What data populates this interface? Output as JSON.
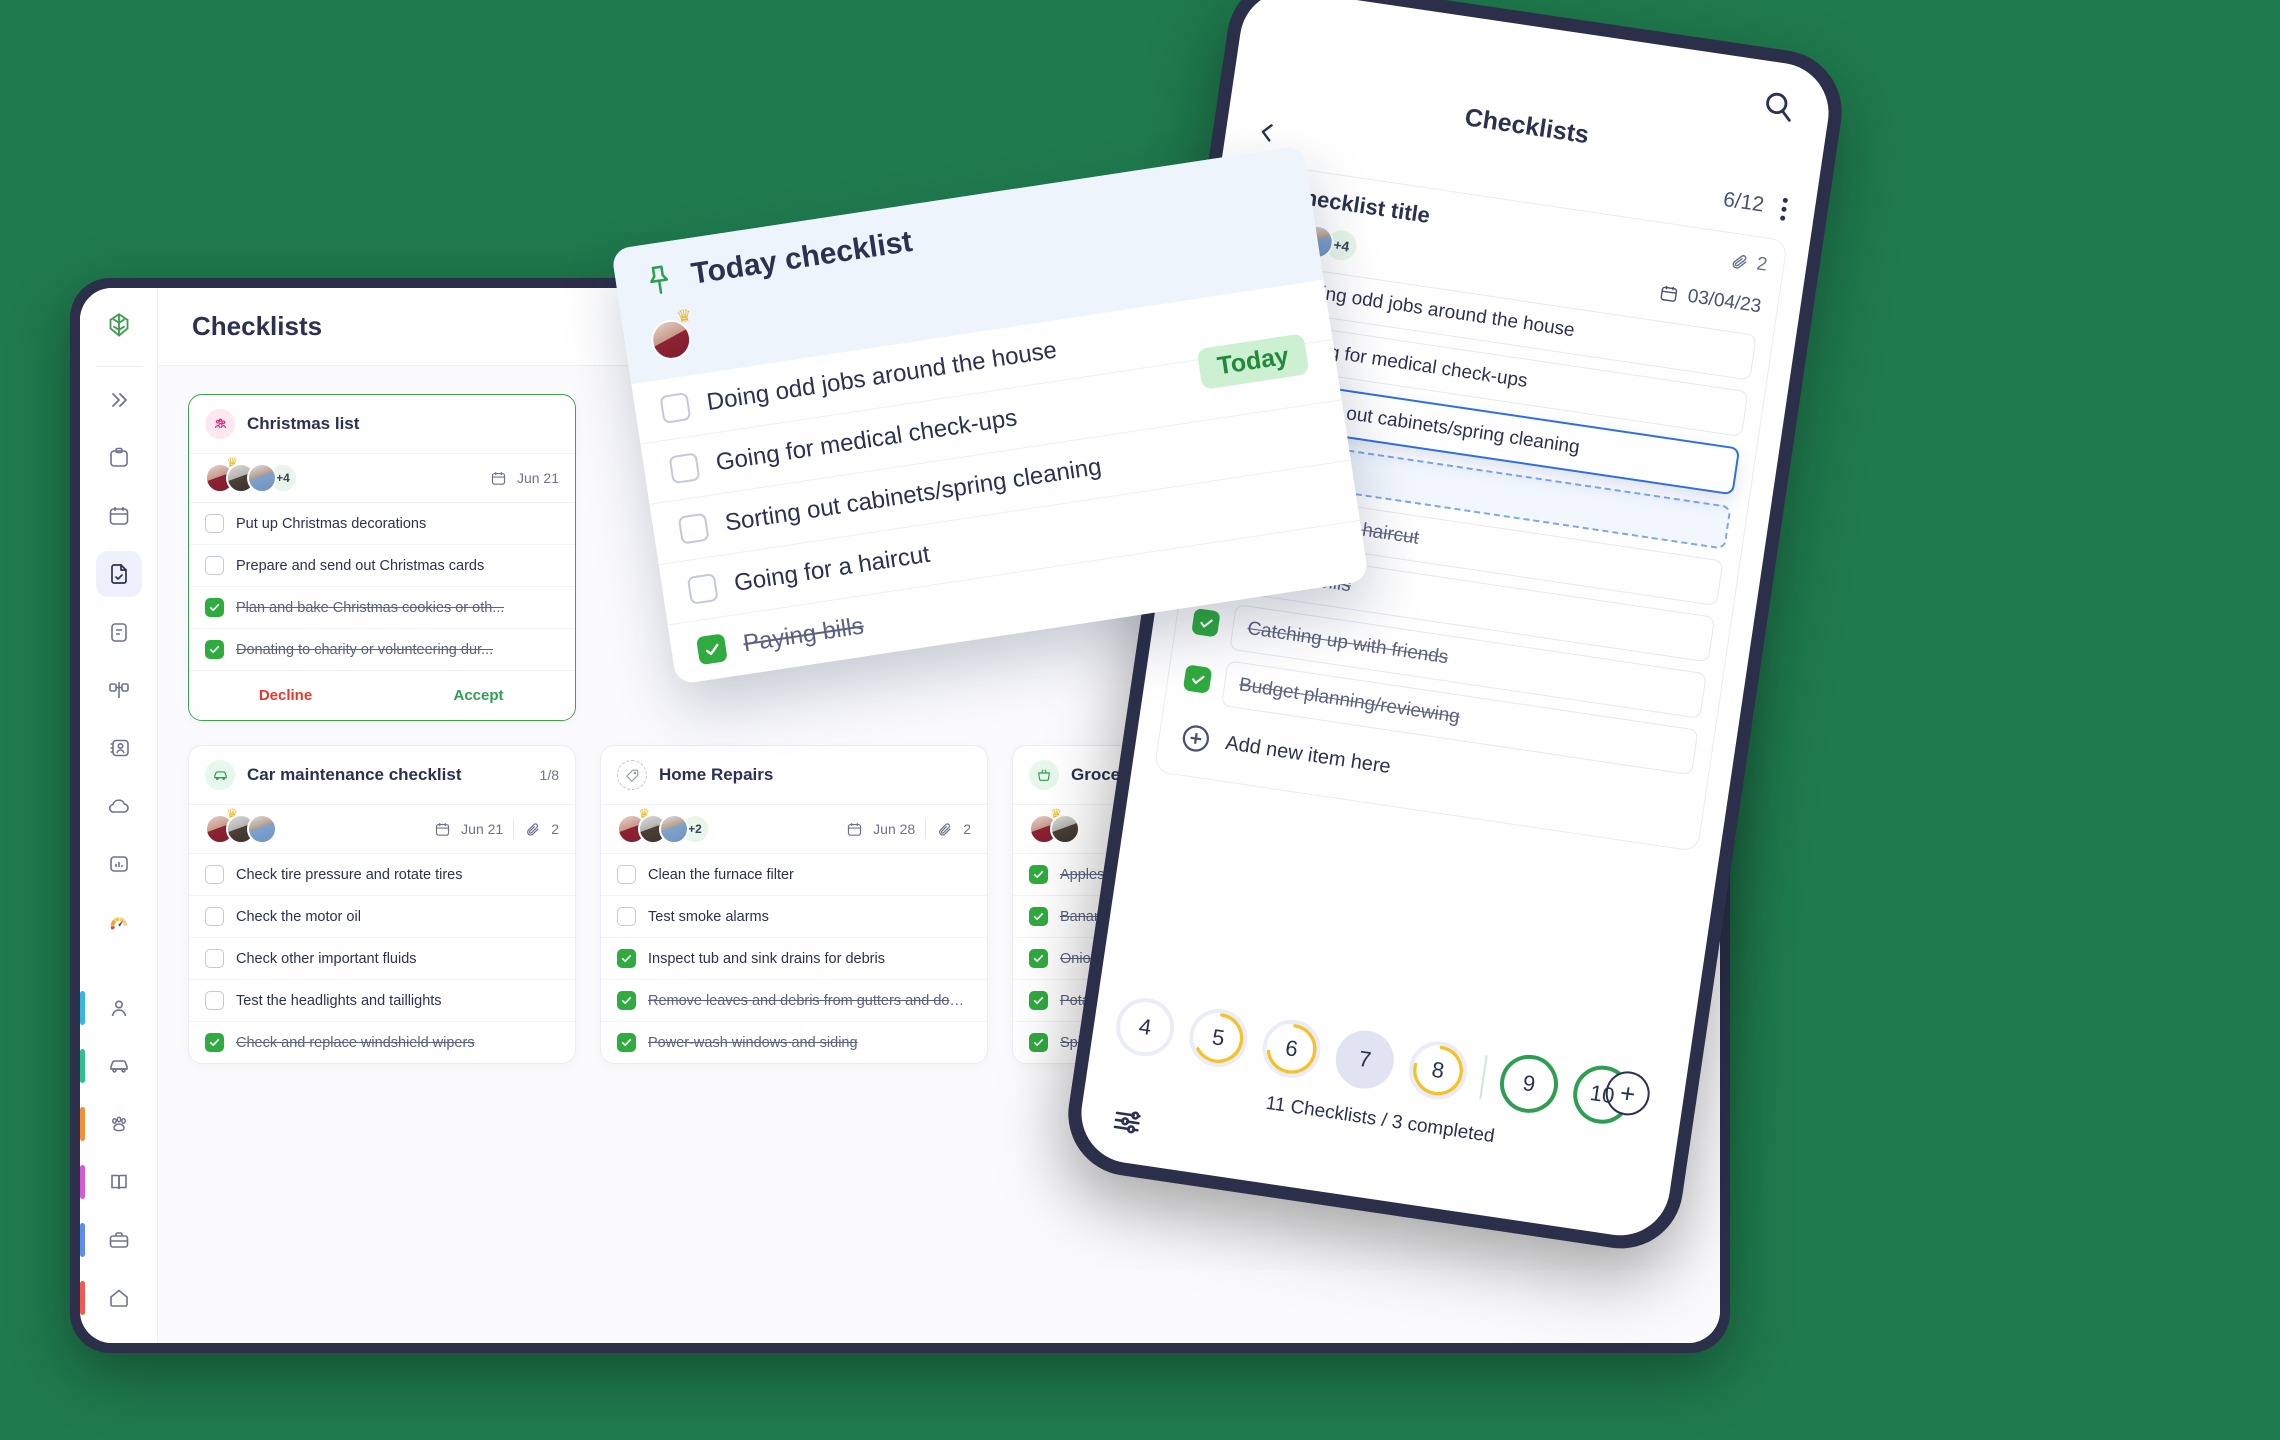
{
  "theme": {
    "background": "#1f7a4d",
    "device_frame": "#2b2f4a",
    "accent_green": "#2fab3f",
    "accent_blue": "#2f6ee0",
    "danger_red": "#e8372b",
    "text_primary": "#2b3150",
    "text_muted": "#6b7390"
  },
  "desktop": {
    "header": {
      "title": "Checklists"
    },
    "sidebar": {
      "logo_icon": "tree-logo-icon",
      "collapse_icon": "chevron-double-right-icon",
      "items": [
        {
          "icon": "clipboard-icon",
          "name": "sidebar-item-clipboard",
          "active": false
        },
        {
          "icon": "calendar-icon",
          "name": "sidebar-item-calendar",
          "active": false
        },
        {
          "icon": "checklist-doc-icon",
          "name": "sidebar-item-checklists",
          "active": true
        },
        {
          "icon": "notes-icon",
          "name": "sidebar-item-notes",
          "active": false
        },
        {
          "icon": "chart-flow-icon",
          "name": "sidebar-item-board",
          "active": false
        },
        {
          "icon": "contacts-icon",
          "name": "sidebar-item-contacts",
          "active": false
        },
        {
          "icon": "cloud-icon",
          "name": "sidebar-item-cloud",
          "active": false
        },
        {
          "icon": "stats-icon",
          "name": "sidebar-item-reports",
          "active": false
        },
        {
          "icon": "gauge-icon",
          "name": "sidebar-item-dashboard",
          "active": false
        }
      ],
      "bottom_items": [
        {
          "icon": "person-icon",
          "name": "sidebar-item-profile",
          "accent": "#38b6e0"
        },
        {
          "icon": "car-icon",
          "name": "sidebar-item-vehicles",
          "accent": "#2ec08b"
        },
        {
          "icon": "paw-icon",
          "name": "sidebar-item-pets",
          "accent": "#f09035"
        },
        {
          "icon": "book-icon",
          "name": "sidebar-item-library",
          "accent": "#d45ad6"
        },
        {
          "icon": "briefcase-icon",
          "name": "sidebar-item-work",
          "accent": "#5b8df0"
        },
        {
          "icon": "home-icon",
          "name": "sidebar-item-home",
          "accent": "#ef5b4e"
        }
      ]
    },
    "cards": [
      {
        "name": "christmas-list",
        "icon": "family-icon",
        "icon_style": "pink",
        "title": "Christmas list",
        "count": "",
        "date": "Jun 21",
        "attachments": "",
        "avatars_more": "+4",
        "highlight": true,
        "tasks": [
          {
            "label": "Put up Christmas decorations",
            "done": false
          },
          {
            "label": "Prepare and send out Christmas cards",
            "done": false
          },
          {
            "label": "Plan and bake Christmas cookies or oth...",
            "done": true
          },
          {
            "label": "Donating to charity or volunteering dur...",
            "done": true
          }
        ],
        "actions": {
          "decline": "Decline",
          "accept": "Accept"
        }
      },
      {
        "name": "car-maintenance-checklist",
        "icon": "car-icon",
        "icon_style": "green",
        "title": "Car maintenance checklist",
        "count": "1/8",
        "date": "Jun 21",
        "attachments": "2",
        "avatars_more": "",
        "highlight": false,
        "tasks": [
          {
            "label": "Check tire pressure and rotate tires",
            "done": false
          },
          {
            "label": "Check the motor oil",
            "done": false
          },
          {
            "label": "Check other important fluids",
            "done": false
          },
          {
            "label": "Test the headlights and taillights",
            "done": false
          },
          {
            "label": "Check and replace windshield wipers",
            "done": true
          }
        ]
      },
      {
        "name": "home-repairs",
        "icon": "tag-icon",
        "icon_style": "dash",
        "title": "Home Repairs",
        "count": "",
        "date": "Jun 28",
        "attachments": "2",
        "avatars_more": "+2",
        "highlight": false,
        "tasks": [
          {
            "label": "Clean the furnace filter",
            "done": false
          },
          {
            "label": "Test smoke alarms",
            "done": false
          },
          {
            "label": "Inspect tub and sink drains for debris",
            "done": true
          },
          {
            "label": "Remove leaves and debris from gutters and dow...",
            "done": true
          },
          {
            "label": "Power-wash windows and siding",
            "done": true
          }
        ]
      },
      {
        "name": "grocery-list",
        "icon": "basket-icon",
        "icon_style": "green",
        "title": "Grocery list",
        "count": "",
        "date": "",
        "attachments": "",
        "avatars_more": "",
        "highlight": false,
        "tasks": [
          {
            "label": "Apples",
            "done": true
          },
          {
            "label": "Bananas",
            "done": true
          },
          {
            "label": "Onion",
            "done": true
          },
          {
            "label": "Potatoes",
            "done": true
          },
          {
            "label": "Spinach",
            "done": true
          }
        ]
      }
    ]
  },
  "today_card": {
    "pin_icon": "pin-icon",
    "title": "Today checklist",
    "badge": "Today",
    "tasks": [
      {
        "label": "Doing odd jobs around the house",
        "done": false
      },
      {
        "label": "Going for medical check-ups",
        "done": false
      },
      {
        "label": "Sorting out cabinets/spring cleaning",
        "done": false
      },
      {
        "label": "Going for a haircut",
        "done": false
      },
      {
        "label": "Paying bills",
        "done": true
      }
    ]
  },
  "phone": {
    "search_icon": "search-icon",
    "app_title": "Checklists",
    "back_icon": "chevron-left-icon",
    "progress_fraction": "6/12",
    "menu_icon": "kebab-menu-icon",
    "card": {
      "tag_icon": "bag-icon",
      "title": "Checklist title",
      "attach_icon": "paperclip-icon",
      "attachments": "2",
      "calendar_icon": "calendar-icon",
      "date": "03/04/23",
      "avatars_more": "+4",
      "tasks": [
        {
          "label": "Doing odd jobs around the house",
          "done": false,
          "state": "normal"
        },
        {
          "label": "Going for medical check-ups",
          "done": false,
          "state": "normal"
        },
        {
          "label": "Sorting out cabinets/spring cleaning",
          "done": false,
          "state": "dragging"
        },
        {
          "label": "Going for a haircut",
          "done": true,
          "state": "normal"
        },
        {
          "label": "Paying bills",
          "done": true,
          "state": "normal"
        },
        {
          "label": "Catching up with friends",
          "done": true,
          "state": "normal"
        },
        {
          "label": "Budget planning/reviewing",
          "done": true,
          "state": "normal"
        }
      ],
      "add_item_label": "Add new item here",
      "add_item_icon": "plus-circle-icon"
    },
    "steps": [
      {
        "num": "4",
        "state": "empty"
      },
      {
        "num": "5",
        "state": "partial"
      },
      {
        "num": "6",
        "state": "partial"
      },
      {
        "num": "7",
        "state": "current"
      },
      {
        "num": "8",
        "state": "partial"
      },
      {
        "num": "9",
        "state": "complete"
      },
      {
        "num": "10",
        "state": "complete"
      }
    ],
    "summary": "11 Checklists / 3 completed",
    "filter_icon": "sliders-icon",
    "fab_icon": "plus-icon"
  }
}
